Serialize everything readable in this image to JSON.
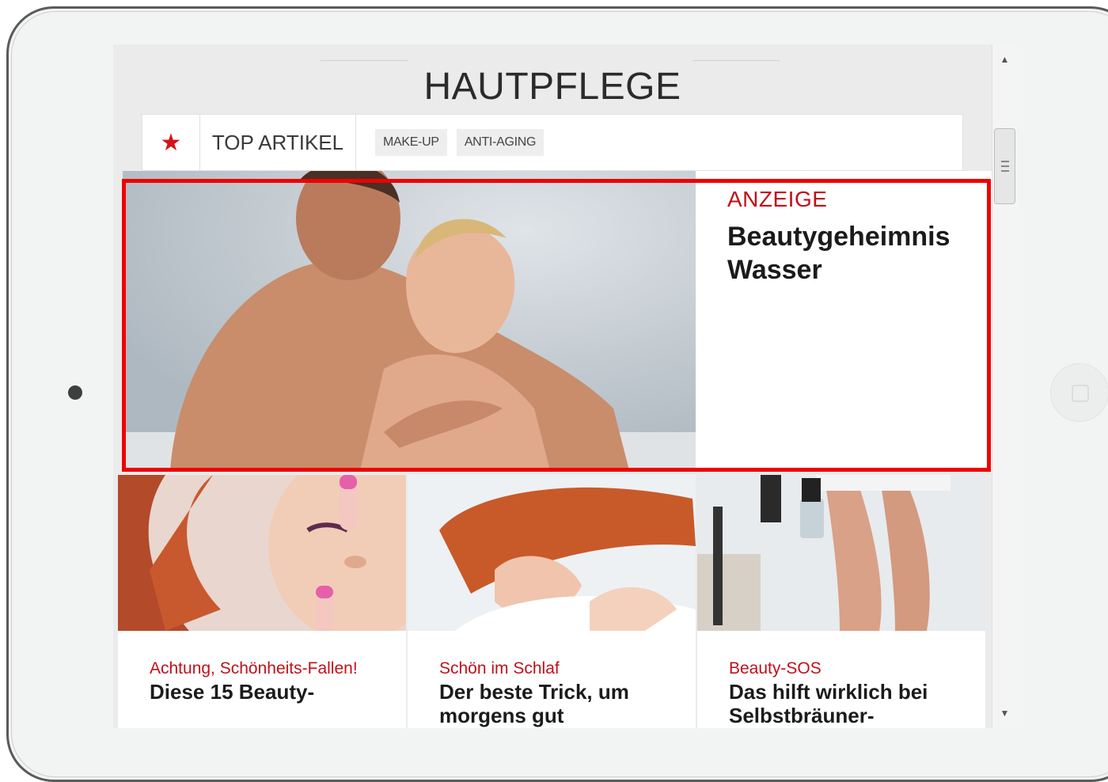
{
  "header": {
    "title": "HAUTPFLEGE"
  },
  "tabs": {
    "star_icon": "★",
    "top_label": "TOP ARTIKEL",
    "categories": [
      "MAKE-UP",
      "ANTI-AGING"
    ]
  },
  "feature": {
    "label": "ANZEIGE",
    "title": "Beautygeheimnis Wasser"
  },
  "cards": [
    {
      "kicker": "Achtung, Schönheits-Fallen!",
      "title": "Diese 15 Beauty-"
    },
    {
      "kicker": "Schön im Schlaf",
      "title": "Der beste Trick, um morgens gut"
    },
    {
      "kicker": "Beauty-SOS",
      "title": "Das hilft wirklich bei Selbstbräuner-"
    }
  ],
  "scrollbar": {
    "up": "▲",
    "down": "▼"
  },
  "colors": {
    "accent": "#c2101a",
    "highlight": "#ee0000"
  }
}
